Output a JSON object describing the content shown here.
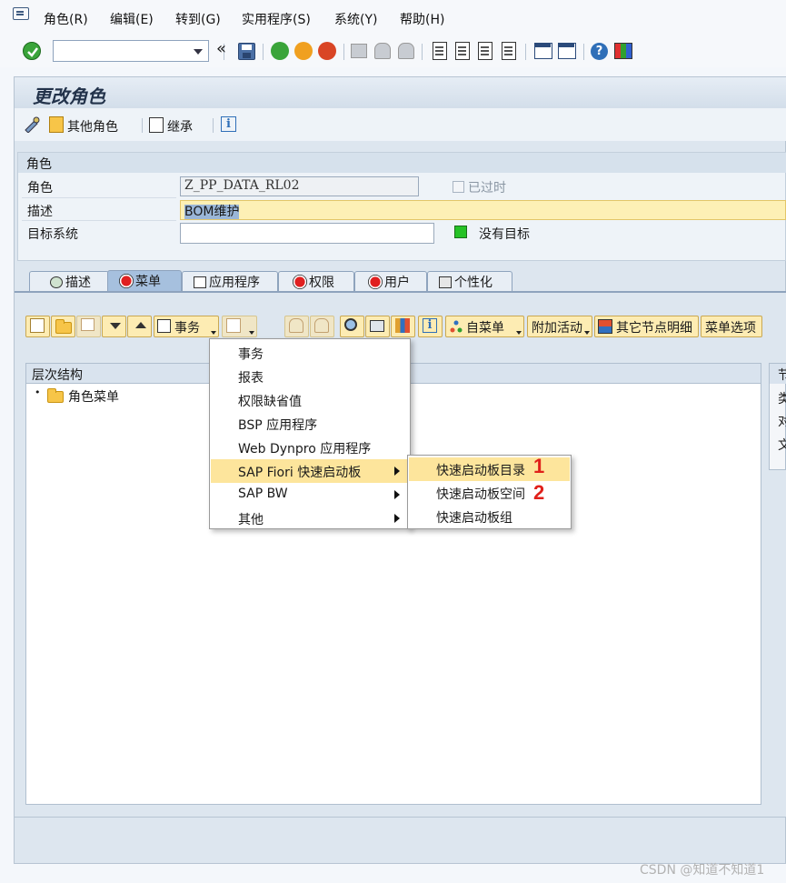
{
  "menubar": {
    "items": [
      "角色(R)",
      "编辑(E)",
      "转到(G)",
      "实用程序(S)",
      "系统(Y)",
      "帮助(H)"
    ]
  },
  "toolbar": {
    "command_value": "",
    "back_glyph": "«"
  },
  "title": "更改角色",
  "app_toolbar": {
    "other_roles": "其他角色",
    "inherit": "继承"
  },
  "role": {
    "section_title": "角色",
    "role_label": "角色",
    "role_value": "Z_PP_DATA_RL02",
    "obsolete_label": "已过时",
    "desc_label": "描述",
    "desc_value": "BOM维护",
    "target_label": "目标系统",
    "target_value": "",
    "no_target_label": "没有目标"
  },
  "tabs": [
    {
      "label": "描述",
      "active": false
    },
    {
      "label": "菜单",
      "active": true
    },
    {
      "label": "应用程序",
      "active": false
    },
    {
      "label": "权限",
      "active": false
    },
    {
      "label": "用户",
      "active": false
    },
    {
      "label": "个性化",
      "active": false
    }
  ],
  "menu_toolbar": {
    "transaction": "事务",
    "from_menu": "自菜单",
    "additional_activities": "附加活动",
    "other_node_details": "其它节点明细",
    "menu_options": "菜单选项"
  },
  "hierarchy": {
    "header": "层次结构",
    "root_node": "角色菜单",
    "right_header": "节",
    "right_rows": [
      "类",
      "对",
      "文"
    ]
  },
  "context_menu": {
    "items": [
      "事务",
      "报表",
      "权限缺省值",
      "BSP 应用程序",
      "Web Dynpro 应用程序",
      "SAP Fiori 快速启动板",
      "SAP BW",
      "其他"
    ],
    "highlighted": "SAP Fiori 快速启动板"
  },
  "submenu": {
    "items": [
      "快速启动板目录",
      "快速启动板空间",
      "快速启动板组"
    ],
    "highlighted": "快速启动板目录"
  },
  "annotations": [
    "1",
    "2"
  ],
  "watermark": "CSDN @知道不知道1",
  "colors": {
    "accent": "#a6c0de",
    "highlight": "#fde59c",
    "annotation": "#e0201a",
    "button": "#fdecb3"
  }
}
